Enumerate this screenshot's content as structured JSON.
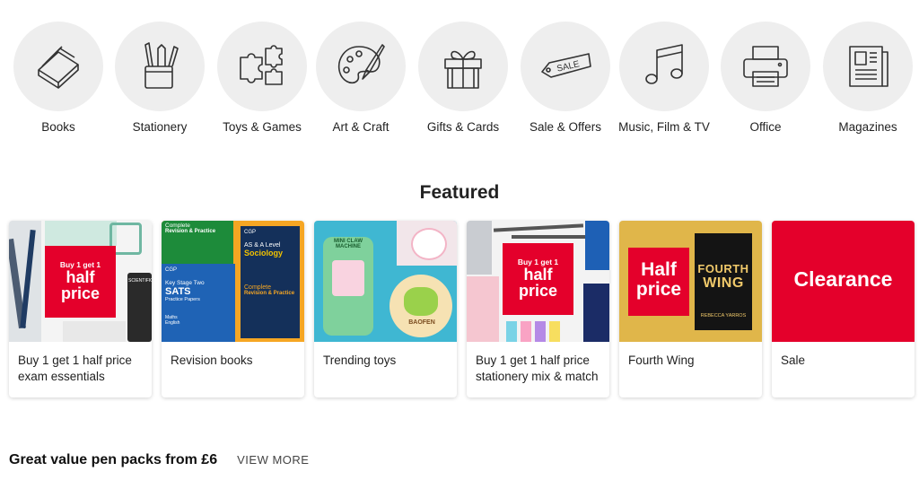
{
  "categories": [
    {
      "label": "Books",
      "icon": "books-icon"
    },
    {
      "label": "Stationery",
      "icon": "pencil-pot-icon"
    },
    {
      "label": "Toys & Games",
      "icon": "jigsaw-icon"
    },
    {
      "label": "Art & Craft",
      "icon": "palette-icon"
    },
    {
      "label": "Gifts & Cards",
      "icon": "gift-icon"
    },
    {
      "label": "Sale & Offers",
      "icon": "sale-tag-icon"
    },
    {
      "label": "Music, Film & TV",
      "icon": "music-note-icon"
    },
    {
      "label": "Office",
      "icon": "printer-icon"
    },
    {
      "label": "Magazines",
      "icon": "magazine-icon"
    }
  ],
  "sale_tag_text": "SALE",
  "featured": {
    "title": "Featured",
    "cards": [
      {
        "caption": "Buy 1 get 1 half price exam essentials",
        "promo": {
          "line1": "Buy 1 get 1",
          "line2": "half",
          "line3": "price"
        },
        "extra": "SCIENTIFIC CALCU"
      },
      {
        "caption": "Revision books",
        "book_texts": {
          "cgp": "CGP",
          "complete": "Complete",
          "revision_practice": "Revision & Practice",
          "ks2": "Key Stage Two",
          "sats": "SATS",
          "practice_papers": "Practice Papers",
          "alevel": "AS & A Level",
          "sociology": "Sociology",
          "maths": "Maths",
          "english": "English"
        }
      },
      {
        "caption": "Trending toys",
        "toy_texts": {
          "claw": "MINI CLAW MACHINE",
          "baofen": "BAOFEN"
        }
      },
      {
        "caption": "Buy 1 get 1 half price stationery mix & match",
        "promo": {
          "line1": "Buy 1 get 1",
          "line2": "half",
          "line3": "price"
        }
      },
      {
        "caption": "Fourth Wing",
        "promo": {
          "line1": "Half",
          "line2": "price"
        },
        "book": {
          "title_top": "FOURTH",
          "title_bottom": "WING",
          "author": "REBECCA YARROS"
        }
      },
      {
        "caption": "Sale",
        "promo": {
          "line1": "Clearance"
        }
      }
    ]
  },
  "pen_packs": {
    "title": "Great value pen packs from £6",
    "view_more": "VIEW MORE"
  },
  "colors": {
    "brand_red": "#e4002b",
    "circle_bg": "#eeeeee"
  }
}
